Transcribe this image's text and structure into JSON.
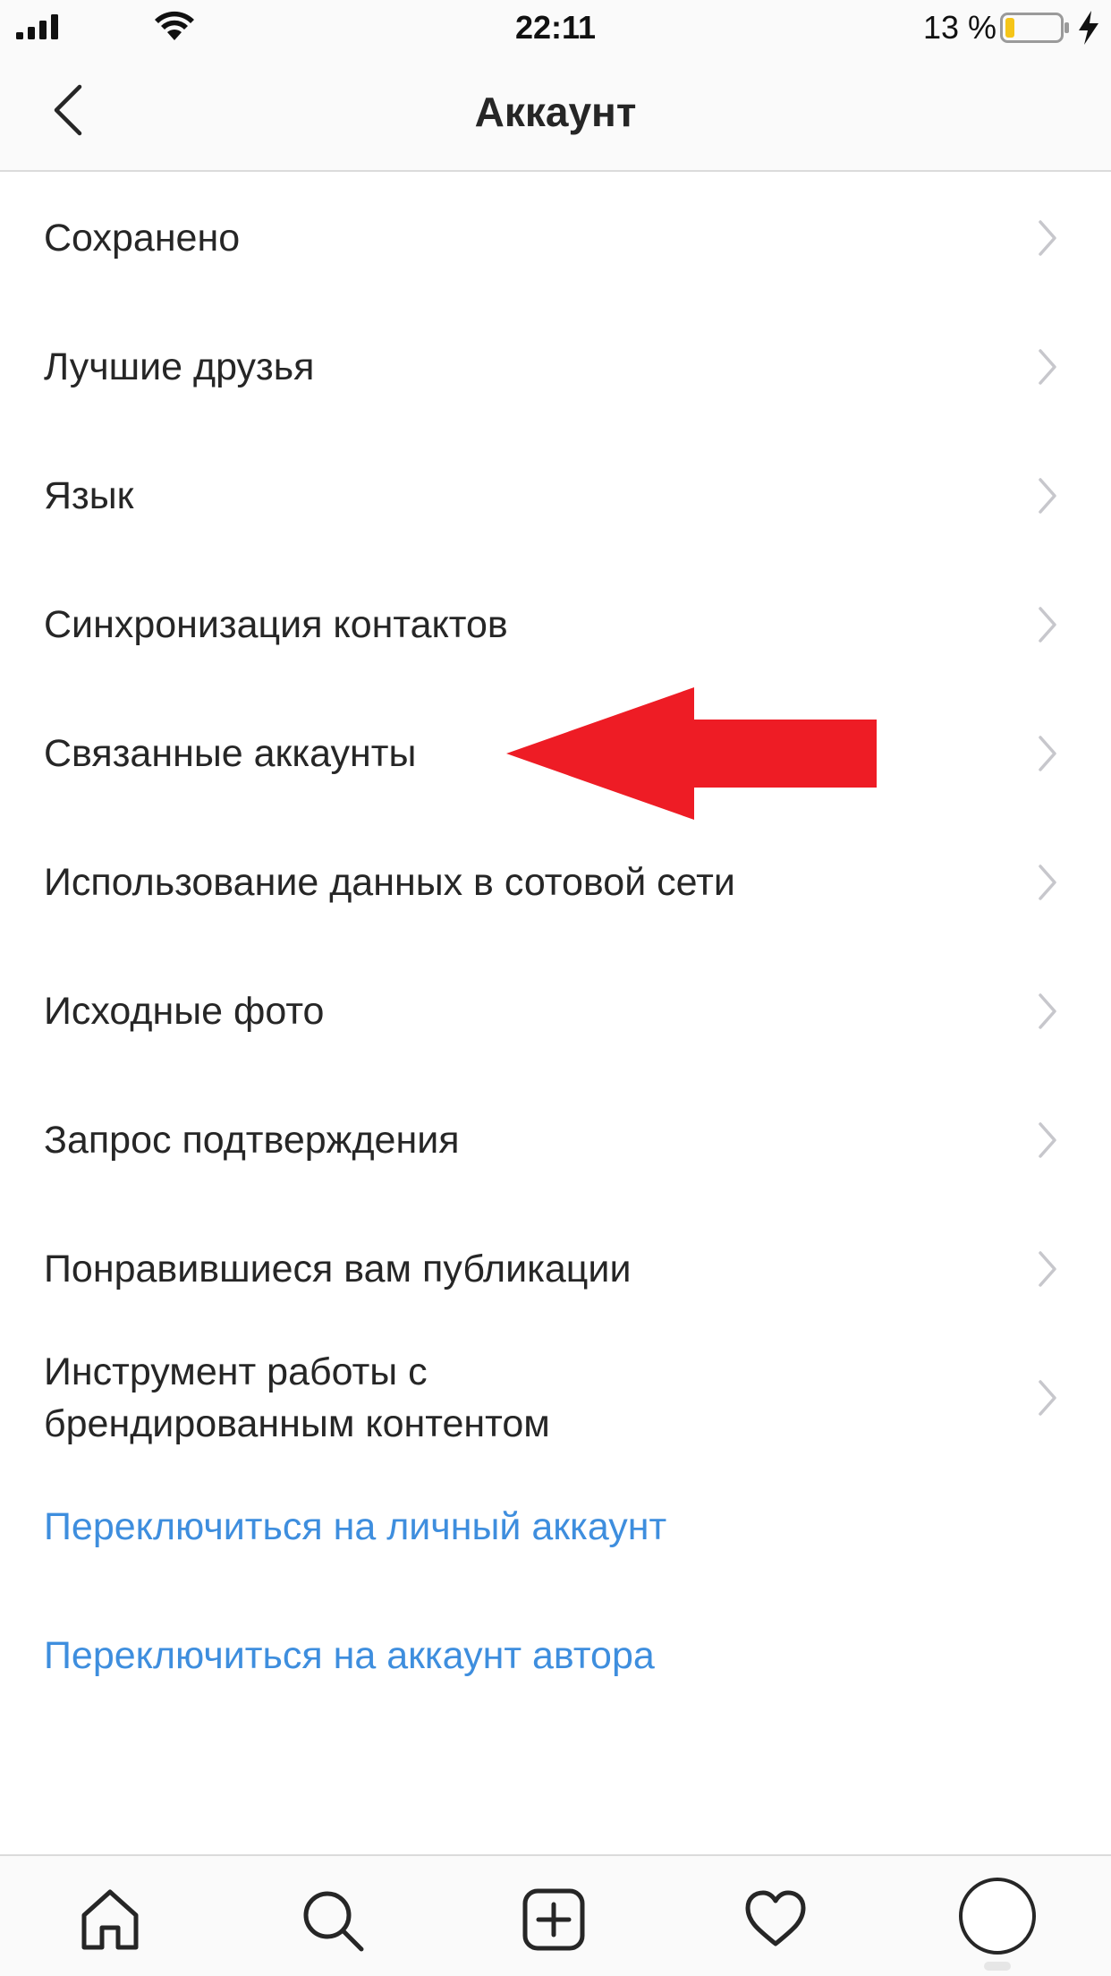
{
  "status_bar": {
    "time": "22:11",
    "battery_percent": "13 %",
    "battery_level": 0.13,
    "icons": [
      "signal-icon",
      "wifi-icon",
      "battery-icon",
      "charging-icon"
    ]
  },
  "header": {
    "title": "Аккаунт",
    "back_icon": "chevron-left-icon"
  },
  "menu": {
    "items": [
      {
        "label": "Сохранено"
      },
      {
        "label": "Лучшие друзья"
      },
      {
        "label": "Язык"
      },
      {
        "label": "Синхронизация контактов"
      },
      {
        "label": "Связанные аккаунты"
      },
      {
        "label": "Использование данных в сотовой сети"
      },
      {
        "label": "Исходные фото"
      },
      {
        "label": "Запрос подтверждения"
      },
      {
        "label": "Понравившиеся вам публикации"
      },
      {
        "label": "Инструмент работы с брендированным контентом"
      }
    ],
    "links": [
      {
        "label": "Переключиться на личный аккаунт"
      },
      {
        "label": "Переключиться на аккаунт автора"
      }
    ]
  },
  "annotation": {
    "icon": "red-arrow-icon",
    "color": "#ee1c25"
  },
  "tab_bar": {
    "tabs": [
      "home-icon",
      "search-icon",
      "add-icon",
      "heart-icon",
      "profile-icon"
    ]
  },
  "colors": {
    "link": "#3e8ede",
    "text": "#262626",
    "divider": "#dbdbdb",
    "battery_fill": "#f5c518"
  }
}
